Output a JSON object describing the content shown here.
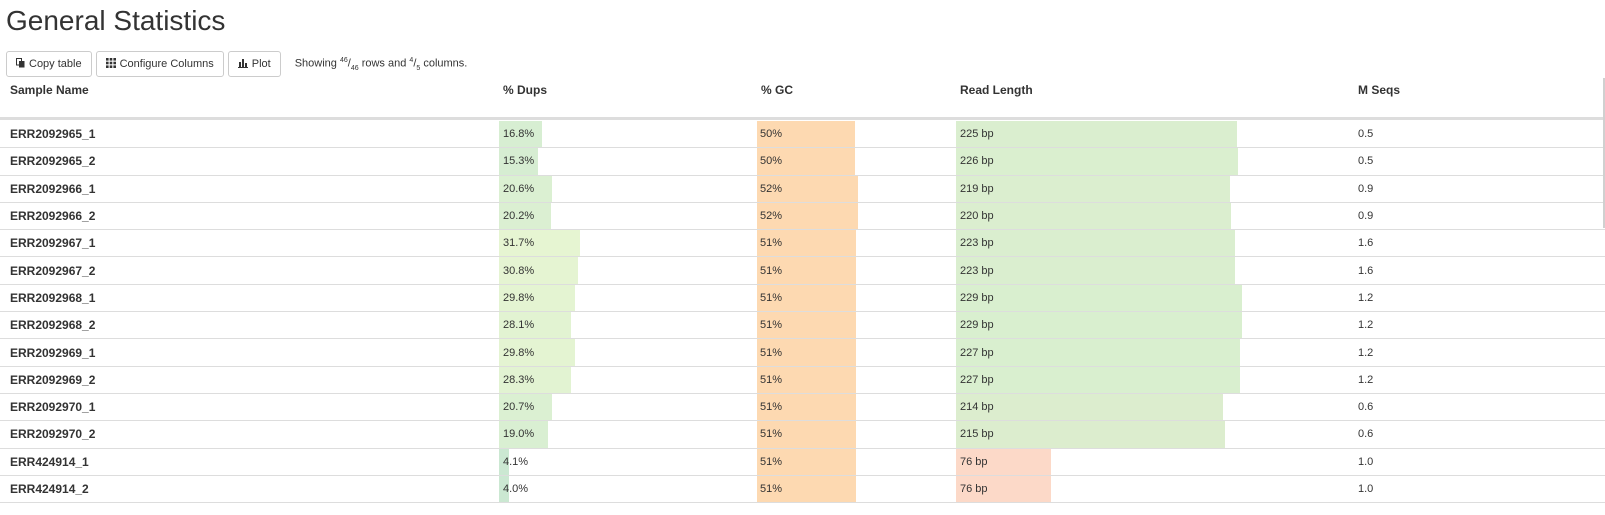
{
  "page": {
    "title": "General Statistics"
  },
  "toolbar": {
    "copy_label": "Copy table",
    "configure_label": "Configure Columns",
    "plot_label": "Plot",
    "status_prefix": "Showing",
    "rows_shown": "46",
    "rows_total": "46",
    "rows_word": "rows and",
    "cols_shown": "4",
    "cols_total": "5",
    "cols_word": "columns."
  },
  "icons": {
    "copy": "copy-icon",
    "configure": "grid-icon",
    "plot": "bar-chart-icon"
  },
  "colors": {
    "dups_high": "#e6f5d2",
    "dups_low": "#c7e6d2",
    "gc": "#fdd9b1",
    "readlen_high": "#d9efcf",
    "readlen_low": "#fcd9c8"
  },
  "table": {
    "columns": [
      "Sample Name",
      "% Dups",
      "% GC",
      "Read Length",
      "M Seqs"
    ],
    "rows": [
      {
        "name": "ERR2092965_1",
        "dups": "16.8%",
        "dups_val": 16.8,
        "gc": "50%",
        "gc_val": 50,
        "read_len": "225 bp",
        "read_len_val": 225,
        "mseqs": "0.5"
      },
      {
        "name": "ERR2092965_2",
        "dups": "15.3%",
        "dups_val": 15.3,
        "gc": "50%",
        "gc_val": 50,
        "read_len": "226 bp",
        "read_len_val": 226,
        "mseqs": "0.5"
      },
      {
        "name": "ERR2092966_1",
        "dups": "20.6%",
        "dups_val": 20.6,
        "gc": "52%",
        "gc_val": 52,
        "read_len": "219 bp",
        "read_len_val": 219,
        "mseqs": "0.9"
      },
      {
        "name": "ERR2092966_2",
        "dups": "20.2%",
        "dups_val": 20.2,
        "gc": "52%",
        "gc_val": 52,
        "read_len": "220 bp",
        "read_len_val": 220,
        "mseqs": "0.9"
      },
      {
        "name": "ERR2092967_1",
        "dups": "31.7%",
        "dups_val": 31.7,
        "gc": "51%",
        "gc_val": 51,
        "read_len": "223 bp",
        "read_len_val": 223,
        "mseqs": "1.6"
      },
      {
        "name": "ERR2092967_2",
        "dups": "30.8%",
        "dups_val": 30.8,
        "gc": "51%",
        "gc_val": 51,
        "read_len": "223 bp",
        "read_len_val": 223,
        "mseqs": "1.6"
      },
      {
        "name": "ERR2092968_1",
        "dups": "29.8%",
        "dups_val": 29.8,
        "gc": "51%",
        "gc_val": 51,
        "read_len": "229 bp",
        "read_len_val": 229,
        "mseqs": "1.2"
      },
      {
        "name": "ERR2092968_2",
        "dups": "28.1%",
        "dups_val": 28.1,
        "gc": "51%",
        "gc_val": 51,
        "read_len": "229 bp",
        "read_len_val": 229,
        "mseqs": "1.2"
      },
      {
        "name": "ERR2092969_1",
        "dups": "29.8%",
        "dups_val": 29.8,
        "gc": "51%",
        "gc_val": 51,
        "read_len": "227 bp",
        "read_len_val": 227,
        "mseqs": "1.2"
      },
      {
        "name": "ERR2092969_2",
        "dups": "28.3%",
        "dups_val": 28.3,
        "gc": "51%",
        "gc_val": 51,
        "read_len": "227 bp",
        "read_len_val": 227,
        "mseqs": "1.2"
      },
      {
        "name": "ERR2092970_1",
        "dups": "20.7%",
        "dups_val": 20.7,
        "gc": "51%",
        "gc_val": 51,
        "read_len": "214 bp",
        "read_len_val": 214,
        "mseqs": "0.6"
      },
      {
        "name": "ERR2092970_2",
        "dups": "19.0%",
        "dups_val": 19.0,
        "gc": "51%",
        "gc_val": 51,
        "read_len": "215 bp",
        "read_len_val": 215,
        "mseqs": "0.6"
      },
      {
        "name": "ERR424914_1",
        "dups": "4.1%",
        "dups_val": 4.1,
        "gc": "51%",
        "gc_val": 51,
        "read_len": "76 bp",
        "read_len_val": 76,
        "mseqs": "1.0"
      },
      {
        "name": "ERR424914_2",
        "dups": "4.0%",
        "dups_val": 4.0,
        "gc": "51%",
        "gc_val": 51,
        "read_len": "76 bp",
        "read_len_val": 76,
        "mseqs": "1.0"
      }
    ]
  }
}
